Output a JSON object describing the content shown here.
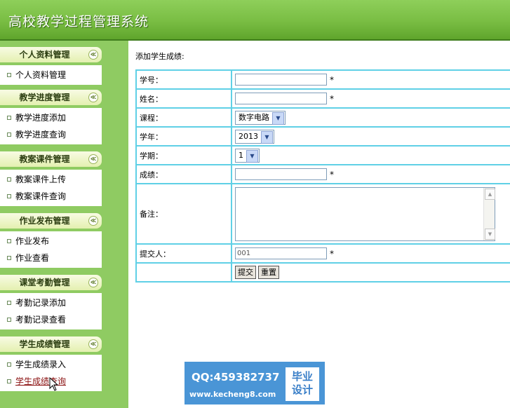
{
  "header": {
    "title": "高校教学过程管理系统"
  },
  "sidebar": {
    "groups": [
      {
        "title": "个人资料管理",
        "items": [
          "个人资料管理"
        ]
      },
      {
        "title": "教学进度管理",
        "items": [
          "教学进度添加",
          "教学进度查询"
        ]
      },
      {
        "title": "教案课件管理",
        "items": [
          "教案课件上传",
          "教案课件查询"
        ]
      },
      {
        "title": "作业发布管理",
        "items": [
          "作业发布",
          "作业查看"
        ]
      },
      {
        "title": "课堂考勤管理",
        "items": [
          "考勤记录添加",
          "考勤记录查看"
        ]
      },
      {
        "title": "学生成绩管理",
        "items": [
          "学生成绩录入",
          "学生成绩查询"
        ]
      }
    ],
    "collapse_glyph": "≪"
  },
  "main": {
    "title": "添加学生成绩:",
    "form": {
      "student_id_label": "学号：",
      "name_label": "姓名：",
      "course_label": "课程：",
      "course_value": "数字电路",
      "year_label": "学年：",
      "year_value": "2013",
      "term_label": "学期：",
      "term_value": "1",
      "score_label": "成绩：",
      "remark_label": "备注：",
      "submitter_label": "提交人：",
      "submitter_value": "001",
      "required_mark": "*",
      "submit_label": "提交",
      "reset_label": "重置"
    }
  },
  "ad": {
    "qq": "QQ:459382737",
    "url": "www.kecheng8.com",
    "badge_line1": "毕业",
    "badge_line2": "设计"
  }
}
